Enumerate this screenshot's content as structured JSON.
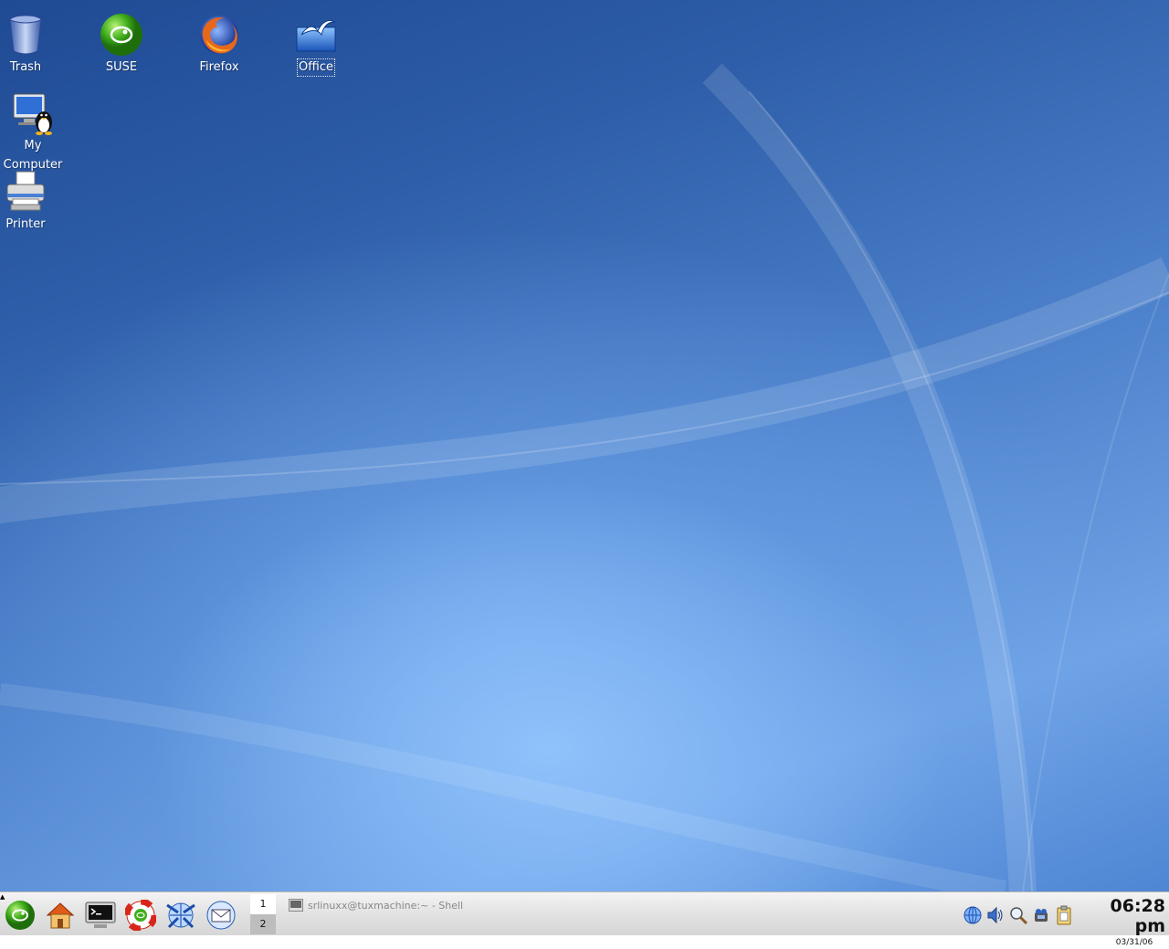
{
  "desktop": {
    "icons": [
      {
        "id": "trash",
        "label": "Trash",
        "icon": "trash-icon"
      },
      {
        "id": "suse",
        "label": "SUSE",
        "icon": "suse-icon"
      },
      {
        "id": "firefox",
        "label": "Firefox",
        "icon": "firefox-icon"
      },
      {
        "id": "office",
        "label": "Office",
        "icon": "office-icon",
        "selected": true
      },
      {
        "id": "my-computer",
        "label_line1": "My",
        "label_line2": "Computer",
        "icon": "computer-tux-icon"
      },
      {
        "id": "printer",
        "label": "Printer",
        "icon": "printer-icon"
      }
    ],
    "colors": {
      "wallpaper_dark": "#1f4a94",
      "wallpaper_light": "#8fc0ff"
    }
  },
  "taskbar": {
    "launchers": [
      {
        "icon": "suse-menu-icon"
      },
      {
        "icon": "home-icon"
      },
      {
        "icon": "terminal-icon"
      },
      {
        "icon": "help-lifebuoy-icon"
      },
      {
        "icon": "konqueror-icon"
      },
      {
        "icon": "mail-icon"
      }
    ],
    "pager": {
      "desktop1": "1",
      "desktop2": "2",
      "active": "1"
    },
    "task": {
      "title": "srlinuxx@tuxmachine:~ - Shell",
      "icon": "shell-icon"
    },
    "tray": [
      {
        "icon": "network-globe-icon"
      },
      {
        "icon": "volume-icon"
      },
      {
        "icon": "search-icon"
      },
      {
        "icon": "updater-icon"
      },
      {
        "icon": "clipboard-icon"
      }
    ],
    "clock": {
      "time": "06:28 pm",
      "date": "03/31/06"
    }
  }
}
